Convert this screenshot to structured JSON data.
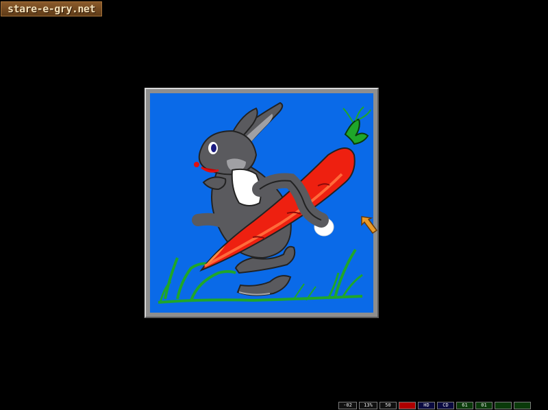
{
  "logo": {
    "text": "stare-e-gry.net"
  },
  "picture": {
    "background_color": "#0a6ae8",
    "frame_color": "#8e8e8e",
    "subject": "rabbit-carrying-carrot"
  },
  "status_bar": {
    "cells": [
      {
        "text": "-02",
        "color": "#101010"
      },
      {
        "text": "13%",
        "color": "#101010"
      },
      {
        "text": "50",
        "color": "#101010"
      },
      {
        "text": "",
        "color": "#b00000"
      },
      {
        "text": "HD",
        "color": "#0a0a40"
      },
      {
        "text": "CD",
        "color": "#0a0a40"
      },
      {
        "text": "61",
        "color": "#0a3a0a"
      },
      {
        "text": "01",
        "color": "#0a3a0a"
      },
      {
        "text": "",
        "color": "#0a3a0a"
      },
      {
        "text": "",
        "color": "#0a3a0a"
      }
    ]
  },
  "cursor": {
    "icon": "arrow-cursor-icon",
    "color": "#e89a28"
  }
}
